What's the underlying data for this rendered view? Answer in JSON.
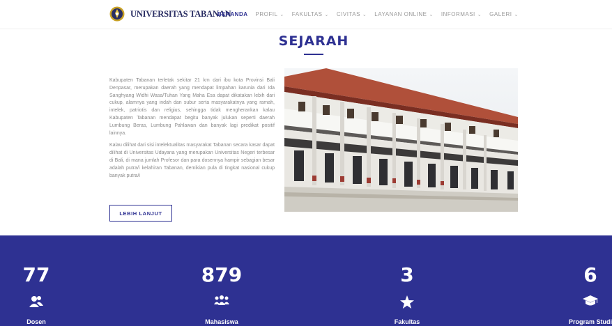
{
  "brand": {
    "name": "UNIVERSITAS TABANAN"
  },
  "nav": {
    "items": [
      {
        "label": "BERANDA",
        "active": true,
        "dropdown": false
      },
      {
        "label": "PROFIL",
        "active": false,
        "dropdown": true
      },
      {
        "label": "FAKULTAS",
        "active": false,
        "dropdown": true
      },
      {
        "label": "CIVITAS",
        "active": false,
        "dropdown": true
      },
      {
        "label": "LAYANAN ONLINE",
        "active": false,
        "dropdown": true
      },
      {
        "label": "INFORMASI",
        "active": false,
        "dropdown": true
      },
      {
        "label": "GALERI",
        "active": false,
        "dropdown": true
      }
    ]
  },
  "history": {
    "title": "SEJARAH",
    "paragraph1": "Kabupaten Tabanan terletak sekitar 21 km dari ibu kota Provinsi Bali Denpasar, merupakan daerah yang mendapat limpahan karunia dari Ida Sanghyang Widhi Wasa/Tuhan Yang Maha Esa dapat dikatakan lebih dari cukup, alamnya yang indah dan subur serta masyarakatnya yang ramah, intelek, patriotis dan religius, sehingga tidak mengherankan kalau Kabupaten Tabanan mendapat begitu banyak julukan seperti daerah Lumbung Beras, Lumbung Pahlawan dan banyak lagi predikat positif lainnya.",
    "paragraph2": "Kalau dilihat dari sisi intelektualitas masyarakat Tabanan secara kasar dapat dilihat di Universitas Udayana yang merupakan Universitas Negeri terbesar di Bali, di mana jumlah Profesor dan para dosennya hampir sebagian besar adalah putra/i kelahiran Tabanan, demikian pula di tingkat nasional cukup banyak putra/i",
    "button_label": "LEBIH LANJUT"
  },
  "colors": {
    "accent": "#2e3192",
    "stats_bg": "#2e3192",
    "text_muted": "#8a8a8a"
  },
  "stats": [
    {
      "value": "77",
      "label": "Dosen",
      "icon": "lecturers-icon"
    },
    {
      "value": "879",
      "label": "Mahasiswa",
      "icon": "students-icon"
    },
    {
      "value": "3",
      "label": "Fakultas",
      "icon": "star-icon"
    },
    {
      "value": "6",
      "label": "Program Studi",
      "icon": "graduation-cap-icon"
    }
  ]
}
